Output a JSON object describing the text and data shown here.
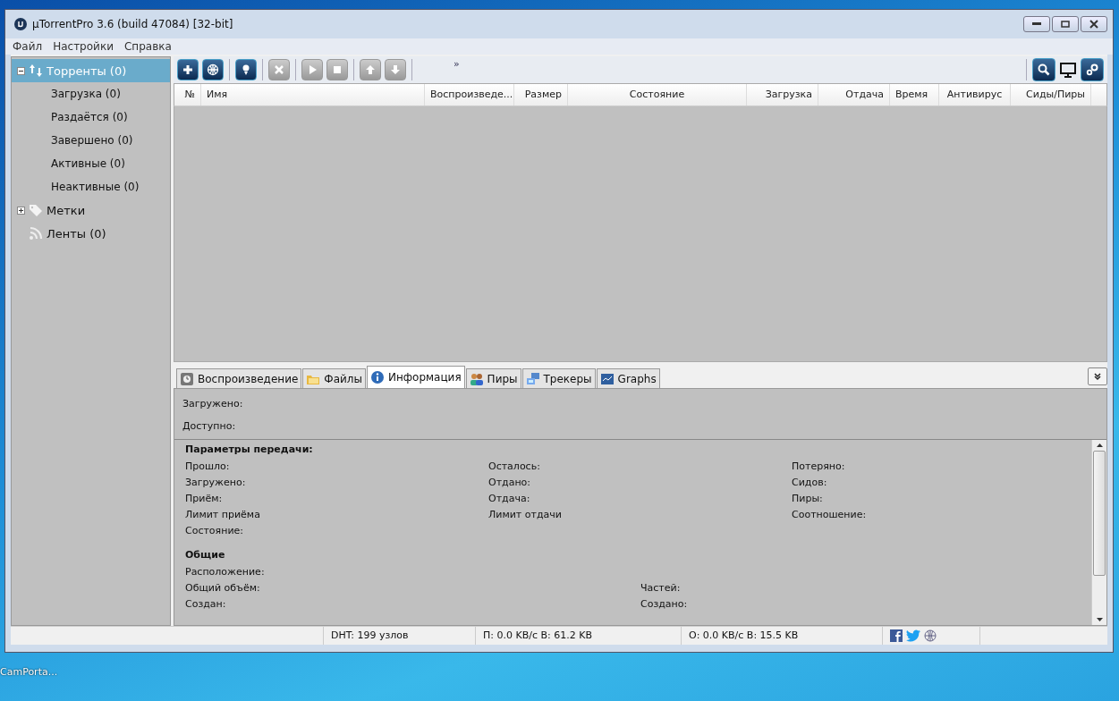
{
  "desktop": {
    "icon_label": "CamPorta..."
  },
  "window": {
    "title": "µTorrentPro 3.6  (build 47084) [32-bit]"
  },
  "menu": [
    "Файл",
    "Настройки",
    "Справка"
  ],
  "sidebar": {
    "items": [
      {
        "kind": "torrents",
        "label": "Торренты (0)",
        "selected": true,
        "expanded": true,
        "children": [
          {
            "label": "Загрузка (0)",
            "selected": false
          },
          {
            "label": "Раздаётся (0)",
            "selected": false
          },
          {
            "label": "Завершено (0)",
            "selected": false
          },
          {
            "label": "Активные (0)",
            "selected": false
          },
          {
            "label": "Неактивные (0)",
            "selected": false
          }
        ]
      },
      {
        "kind": "labels",
        "label": "Метки",
        "selected": false,
        "expanded": false
      },
      {
        "kind": "feeds",
        "label": "Ленты (0)",
        "selected": false
      }
    ]
  },
  "toolbar": {
    "buttons": [
      {
        "kind": "add",
        "disabled": false
      },
      {
        "kind": "add-url",
        "disabled": false
      },
      {
        "kind": "create",
        "disabled": false
      },
      {
        "kind": "remove",
        "disabled": true
      },
      {
        "kind": "start",
        "disabled": true
      },
      {
        "kind": "stop",
        "disabled": true
      },
      {
        "kind": "up",
        "disabled": true
      },
      {
        "kind": "down",
        "disabled": true
      }
    ],
    "overflow": "»",
    "right_buttons": [
      {
        "kind": "search"
      },
      {
        "kind": "monitor"
      },
      {
        "kind": "settings"
      }
    ]
  },
  "table": {
    "columns": [
      {
        "label": "№"
      },
      {
        "label": "Имя"
      },
      {
        "label": "Воспроизведе..."
      },
      {
        "label": "Размер"
      },
      {
        "label": "Состояние"
      },
      {
        "label": "Загрузка"
      },
      {
        "label": "Отдача"
      },
      {
        "label": "Время"
      },
      {
        "label": "Антивирус"
      },
      {
        "label": "Сиды/Пиры"
      }
    ]
  },
  "detail_tabs": [
    {
      "kind": "play",
      "label": "Воспроизведение",
      "selected": false
    },
    {
      "kind": "files",
      "label": "Файлы",
      "selected": false
    },
    {
      "kind": "info",
      "label": "Информация",
      "selected": true
    },
    {
      "kind": "peers",
      "label": "Пиры",
      "selected": false
    },
    {
      "kind": "trackers",
      "label": "Трекеры",
      "selected": false
    },
    {
      "kind": "graphs",
      "label": "Graphs",
      "selected": false
    }
  ],
  "info": {
    "summary": [
      "Загружено:",
      "Доступно:"
    ],
    "sections": [
      {
        "kind": "transfer",
        "title": "Параметры передачи:",
        "rows": [
          [
            "Прошло:",
            "Осталось:",
            "Потеряно:"
          ],
          [
            "Загружено:",
            "Отдано:",
            "Сидов:"
          ],
          [
            "Приём:",
            "Отдача:",
            "Пиры:"
          ],
          [
            "Лимит приёма",
            "Лимит отдачи",
            "Соотношение:"
          ],
          [
            "Состояние:"
          ]
        ]
      },
      {
        "kind": "general",
        "title": "Общие",
        "rows": [
          [
            "Расположение:"
          ],
          [
            "Общий объём:",
            "Частей:"
          ],
          [
            "Создан:",
            "Создано:"
          ]
        ]
      }
    ]
  },
  "status_bar": [
    "DHT: 199 узлов",
    "П: 0.0 KB/с В: 61.2 KB",
    "О: 0.0 KB/с В: 15.5 KB"
  ]
}
